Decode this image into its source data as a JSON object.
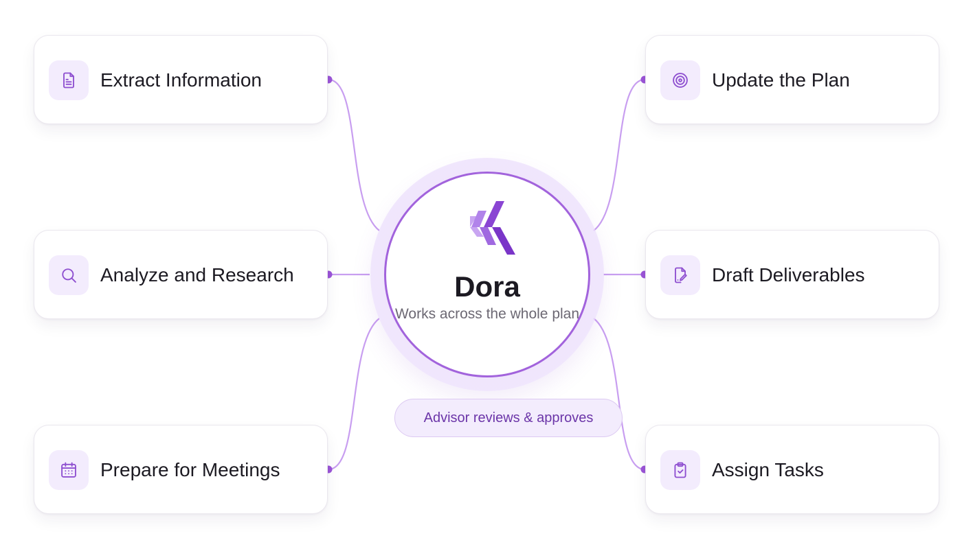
{
  "hub": {
    "title": "Dora",
    "subtitle": "Works across the whole plan"
  },
  "approval": {
    "label": "Advisor reviews & approves"
  },
  "cards": [
    {
      "id": "extract",
      "label": "Extract Information",
      "icon": "document-icon"
    },
    {
      "id": "analyze",
      "label": "Analyze and Research",
      "icon": "search-icon"
    },
    {
      "id": "prepare",
      "label": "Prepare for Meetings",
      "icon": "calendar-icon"
    },
    {
      "id": "update",
      "label": "Update the Plan",
      "icon": "target-icon"
    },
    {
      "id": "draft",
      "label": "Draft Deliverables",
      "icon": "file-edit-icon"
    },
    {
      "id": "assign",
      "label": "Assign Tasks",
      "icon": "clipboard-check-icon"
    }
  ],
  "colors": {
    "accent": "#9c55d8",
    "connector": "#c89ef0",
    "icon_background": "#f3ecfd",
    "text_primary": "#1c1a22",
    "text_secondary": "#6c6873",
    "pill_text": "#6b35a8"
  }
}
